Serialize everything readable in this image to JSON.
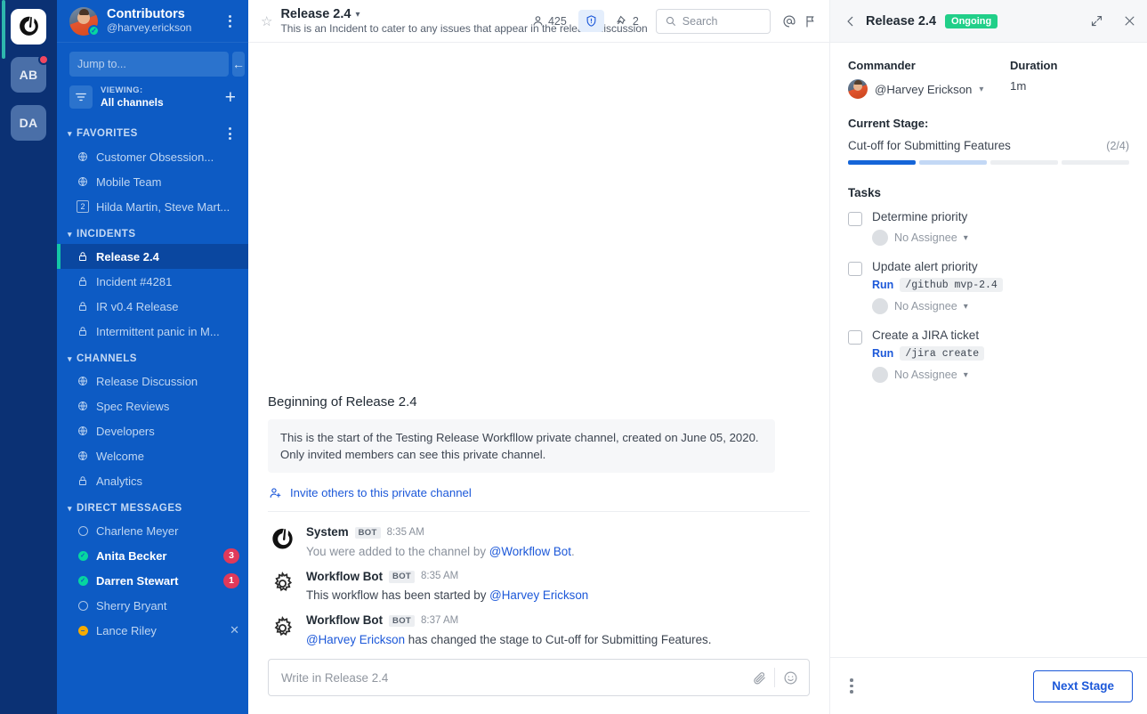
{
  "team_bar": {
    "logo_icon": "mattermost-logo-icon",
    "teams": [
      {
        "initials": "AB",
        "has_unread_dot": true
      },
      {
        "initials": "DA",
        "has_unread_dot": false
      }
    ]
  },
  "sidebar": {
    "team_name": "Contributors",
    "username": "@harvey.erickson",
    "menu_icon": "dots-vertical-icon",
    "jump_to_placeholder": "Jump to...",
    "back_icon": "arrow-left-icon",
    "forward_icon": "arrow-right-icon",
    "filter_icon": "filter-icon",
    "viewing_label": "VIEWING:",
    "viewing_value": "All channels",
    "add_icon": "plus-icon",
    "categories": [
      {
        "name": "FAVORITES",
        "has_menu": true,
        "items": [
          {
            "label": "Customer Obsession...",
            "icon": "globe-icon",
            "type": "public"
          },
          {
            "label": "Mobile Team",
            "icon": "globe-icon",
            "type": "public"
          },
          {
            "label": "Hilda Martin, Steve Mart...",
            "icon": "group-badge",
            "badge": "2",
            "type": "group"
          }
        ]
      },
      {
        "name": "INCIDENTS",
        "has_menu": false,
        "items": [
          {
            "label": "Release 2.4",
            "icon": "lock-icon",
            "type": "private",
            "active": true
          },
          {
            "label": "Incident #4281",
            "icon": "lock-icon",
            "type": "private"
          },
          {
            "label": "IR v0.4 Release",
            "icon": "lock-icon",
            "type": "private"
          },
          {
            "label": "Intermittent panic in M...",
            "icon": "lock-icon",
            "type": "private"
          }
        ]
      },
      {
        "name": "CHANNELS",
        "has_menu": false,
        "items": [
          {
            "label": "Release Discussion",
            "icon": "globe-icon",
            "type": "public"
          },
          {
            "label": "Spec Reviews",
            "icon": "globe-icon",
            "type": "public"
          },
          {
            "label": "Developers",
            "icon": "globe-icon",
            "type": "public"
          },
          {
            "label": "Welcome",
            "icon": "globe-icon",
            "type": "public"
          },
          {
            "label": "Analytics",
            "icon": "lock-icon",
            "type": "private"
          }
        ]
      },
      {
        "name": "DIRECT MESSAGES",
        "has_menu": false,
        "items": [
          {
            "label": "Charlene Meyer",
            "icon": "status-offline-icon",
            "type": "dm",
            "status": "offline"
          },
          {
            "label": "Anita Becker",
            "icon": "status-online-icon",
            "type": "dm",
            "status": "online",
            "unread": true,
            "mentions": "3"
          },
          {
            "label": "Darren Stewart",
            "icon": "status-online-icon",
            "type": "dm",
            "status": "online",
            "unread": true,
            "mentions": "1"
          },
          {
            "label": "Sherry Bryant",
            "icon": "status-offline-icon",
            "type": "dm",
            "status": "offline"
          },
          {
            "label": "Lance Riley",
            "icon": "status-away-icon",
            "type": "dm",
            "status": "away",
            "close_icon": "close-icon"
          }
        ]
      }
    ]
  },
  "channel_header": {
    "star_icon": "star-outline-icon",
    "title": "Release 2.4",
    "chevron": "chevron-down-icon",
    "subtitle": "This is an Incident to cater to any issues that appear in the release discussion",
    "members_icon": "member-icon",
    "members_count": "425",
    "incident_icon": "shield-alert-icon",
    "pin_icon": "pin-icon",
    "pinned_count": "2",
    "search_icon": "search-icon",
    "search_placeholder": "Search",
    "mention_icon": "at-mention-icon",
    "flag_icon": "flag-icon"
  },
  "posts_intro": {
    "title": "Beginning of Release 2.4",
    "body": "This is the start of the Testing Release Workfllow private channel, created on June 05, 2020. Only invited members can see this private channel.",
    "invite_icon": "add-member-icon",
    "invite_label": "Invite others to this private channel"
  },
  "posts": [
    {
      "avatar_icon": "mattermost-logo-icon",
      "author": "System",
      "bot_tag": "BOT",
      "time": "8:35 AM",
      "text_before": "You were added to the channel by ",
      "mention": "@Workflow Bot",
      "text_after": ".",
      "muted": true
    },
    {
      "avatar_icon": "gear-icon",
      "author": "Workflow Bot",
      "bot_tag": "BOT",
      "time": "8:35 AM",
      "text_before": "This workflow has been started by ",
      "mention": "@Harvey Erickson",
      "text_after": "",
      "muted": false
    },
    {
      "avatar_icon": "gear-icon",
      "author": "Workflow Bot",
      "bot_tag": "BOT",
      "time": "8:37 AM",
      "text_before": "",
      "mention": "@Harvey Erickson",
      "text_after": " has changed the stage to Cut-off for Submitting Features.",
      "muted": false
    }
  ],
  "composer": {
    "placeholder": "Write in Release 2.4",
    "attach_icon": "paperclip-icon",
    "emoji_icon": "emoji-smiley-icon"
  },
  "rhs": {
    "back_icon": "chevron-left-icon",
    "title": "Release 2.4",
    "status_badge": "Ongoing",
    "expand_icon": "expand-arrows-icon",
    "close_icon": "close-icon",
    "commander_label": "Commander",
    "commander_name": "@Harvey Erickson",
    "commander_chevron": "chevron-down-icon",
    "duration_label": "Duration",
    "duration_value": "1m",
    "stage_label": "Current Stage:",
    "stage_name": "Cut-off for Submitting Features",
    "stage_count": "(2/4)",
    "progress_segments": [
      "done",
      "partial",
      "empty",
      "empty"
    ],
    "tasks_label": "Tasks",
    "tasks": [
      {
        "name": "Determine priority",
        "checked": false,
        "run_label": null,
        "command": null,
        "assignee": "No Assignee",
        "assignee_chevron": "chevron-down-icon"
      },
      {
        "name": "Update alert priority",
        "checked": false,
        "run_label": "Run",
        "command": "/github mvp-2.4",
        "assignee": "No Assignee",
        "assignee_chevron": "chevron-down-icon"
      },
      {
        "name": "Create a JIRA ticket",
        "checked": false,
        "run_label": "Run",
        "command": "/jira create",
        "assignee": "No Assignee",
        "assignee_chevron": "chevron-down-icon"
      }
    ],
    "footer_menu_icon": "dots-vertical-icon",
    "next_stage_label": "Next Stage"
  },
  "colors": {
    "sidebar_bg": "#0d5bc4",
    "team_bar_bg": "#0b3174",
    "accent_blue": "#1c58d9",
    "ongoing_green": "#21cf89",
    "mention_red": "#e0395a",
    "online_green": "#06d6a0",
    "away_orange": "#f5ab00",
    "active_channel_bg": "#0a47a0",
    "active_channel_accent": "#13c6a7"
  }
}
